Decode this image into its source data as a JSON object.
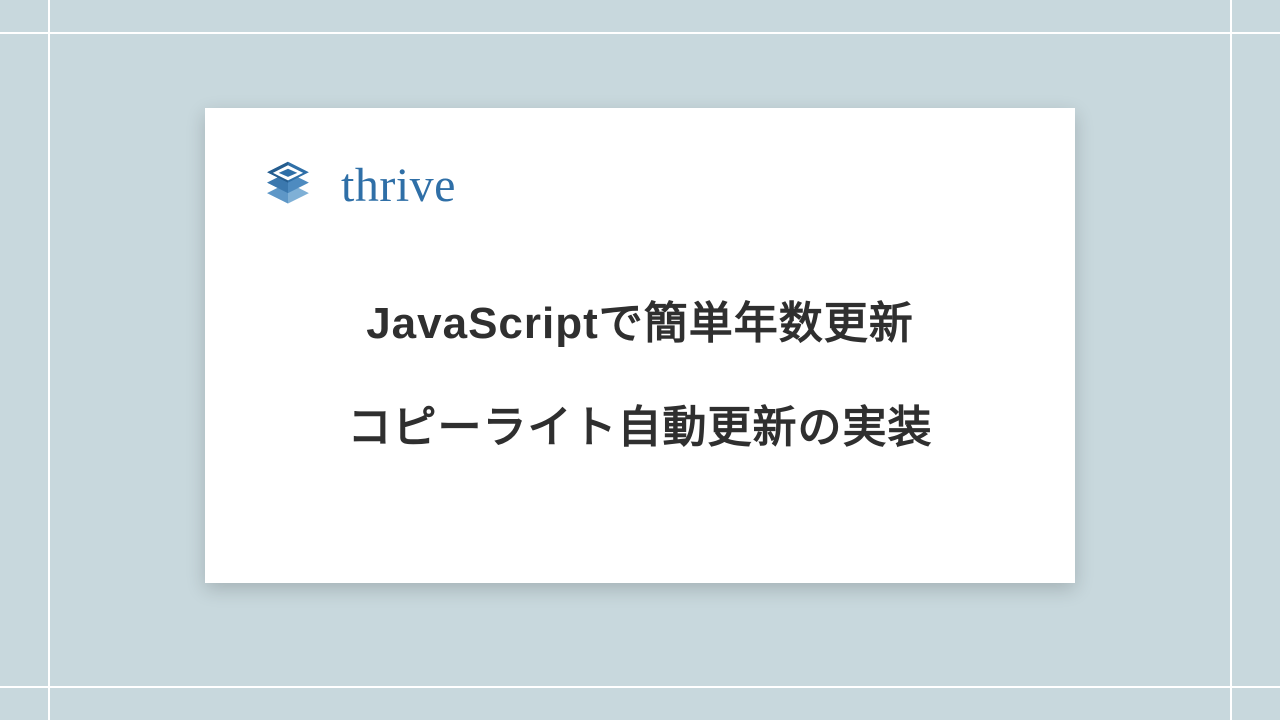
{
  "brand": {
    "name": "thrive",
    "icon": "stacked-layers-icon",
    "color": "#2f6fa7"
  },
  "title": {
    "line1": "JavaScriptで簡単年数更新",
    "line2": "コピーライト自動更新の実装"
  },
  "colors": {
    "background": "#c8d8dd",
    "grid_line": "#ffffff",
    "card_bg": "#ffffff",
    "text": "#2f2f2f"
  }
}
